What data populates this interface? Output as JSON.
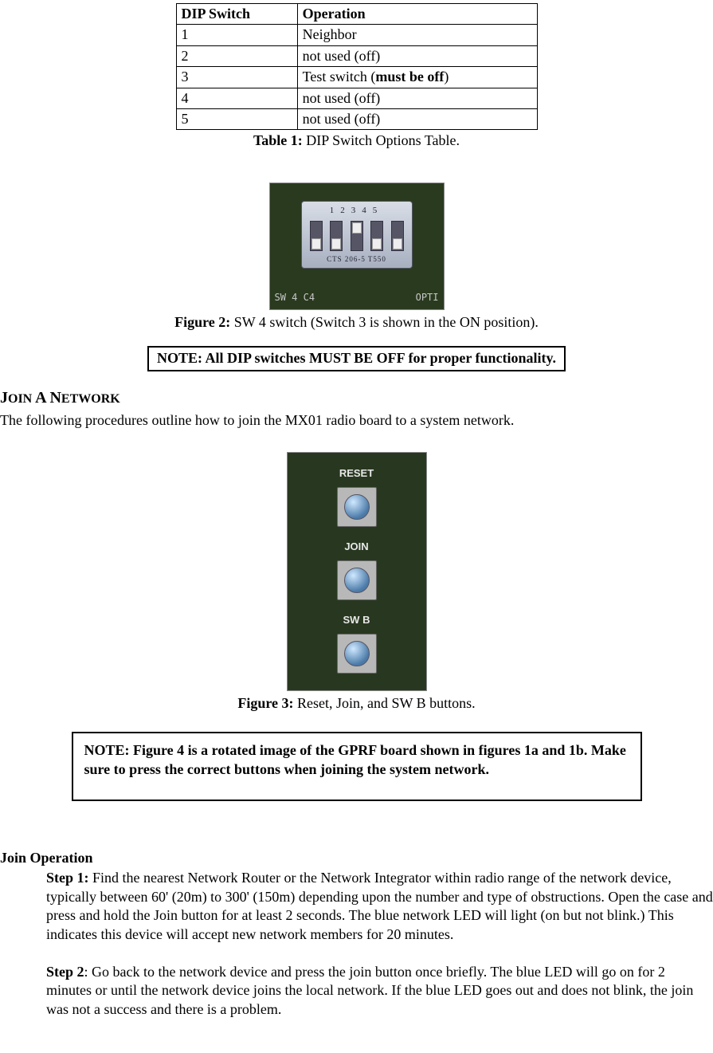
{
  "table": {
    "headers": [
      "DIP Switch",
      "Operation"
    ],
    "rows": [
      {
        "c0": "1",
        "c1": "Neighbor"
      },
      {
        "c0": "2",
        "c1": "not used (off)"
      },
      {
        "c0": "3",
        "c1_pre": "Test switch (",
        "c1_bold": "must be off",
        "c1_post": ")"
      },
      {
        "c0": "4",
        "c1": "not used (off)"
      },
      {
        "c0": "5",
        "c1": "not used (off)"
      }
    ],
    "caption_label": "Table 1:",
    "caption_text": "  DIP Switch Options Table."
  },
  "figure2": {
    "switch_numbers": "12345",
    "switch_chip_label": "CTS 206-5 T550",
    "board_right": "OPTI",
    "board_left": "SW 4   C4",
    "caption_label": "Figure 2:",
    "caption_text": "  SW 4 switch (Switch 3 is shown in the ON position)."
  },
  "note1": "NOTE:  All DIP switches MUST BE OFF for proper functionality.",
  "section_join_network": {
    "heading_pre": "J",
    "heading_word1": "OIN",
    "heading_mid": " A N",
    "heading_word2": "ETWORK",
    "intro": "The following procedures outline how to join the MX01 radio board to a system network."
  },
  "figure3": {
    "labels": {
      "reset": "RESET",
      "join": "JOIN",
      "swb": "SW B"
    },
    "caption_label": "Figure 3:",
    "caption_text": "  Reset, Join, and SW B buttons."
  },
  "note2": "NOTE:  Figure 4 is a rotated image of the GPRF board shown in figures 1a and 1b.   Make sure to press the correct buttons when joining the system network.",
  "join_operation": {
    "heading": "Join Operation",
    "step1_label": "Step 1:",
    "step1_text": "  Find the nearest Network Router or the Network Integrator within radio range of the network device, typically between 60' (20m) to 300' (150m) depending upon the number and type of obstructions. Open the case and press and hold the Join button for at least 2 seconds. The blue network LED will light (on but not blink.) This indicates this device will accept new network members for 20 minutes.",
    "step2_label": "Step 2",
    "step2_text": ": Go back to the network device and press the join button once briefly. The blue LED will go on for 2 minutes or until the network device joins the local network. If the blue LED goes out and does not blink, the join was not a success and there is a problem."
  }
}
